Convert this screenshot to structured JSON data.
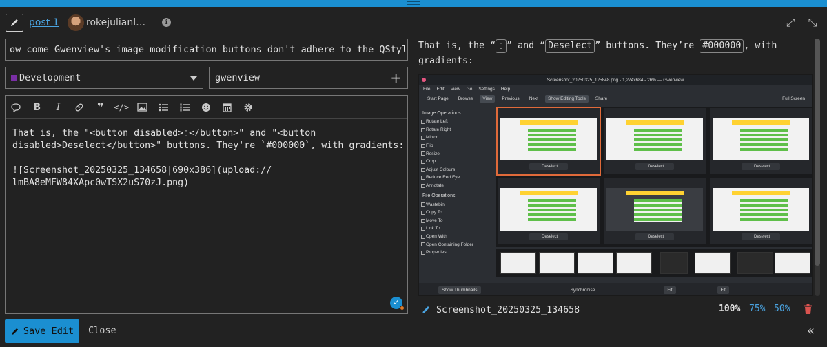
{
  "header": {
    "post_link": "post 1",
    "username": "rokejulianl…"
  },
  "title": "ow come Gwenview's image modification buttons don't adhere to the QStyle?",
  "category": {
    "label": "Development",
    "color": "#7a2fa5"
  },
  "tags": {
    "value": "gwenview"
  },
  "toolbar": {
    "icons": [
      "speech-bubble-icon",
      "bold-icon",
      "italic-icon",
      "link-icon",
      "quote-icon",
      "code-icon",
      "image-icon",
      "bullet-list-icon",
      "numbered-list-icon",
      "emoji-icon",
      "calendar-icon",
      "gear-icon"
    ]
  },
  "editor": {
    "line1": "That is, the \"<button disabled>▯</button>\" and \"<button",
    "line2": "disabled>Deselect</button>\" buttons. They're `#000000`, with gradients:",
    "line3": "",
    "line4": "![Screenshot_20250325_134658|690x386](upload://",
    "line5": "lmBA8eMFW84XApc0wTSX2uS70zJ.png)"
  },
  "actions": {
    "save_label": "Save Edit",
    "close_label": "Close"
  },
  "preview": {
    "text_a": "That is, the “",
    "chip1": "▯",
    "text_b": "” and “",
    "chip2": "Deselect",
    "text_c": "” buttons. They’re ",
    "chip3": "#000000",
    "text_d": ", with",
    "text_e": "gradients:"
  },
  "gwenview": {
    "window_title": "Screenshot_20250325_125848.png - 1,274x684 - 26% — Gwenview",
    "menu": [
      "File",
      "Edit",
      "View",
      "Go",
      "Settings",
      "Help"
    ],
    "tools": [
      "Start Page",
      "Browse",
      "View",
      "Previous",
      "Next",
      "Show Editing Tools",
      "Share"
    ],
    "full_screen": "Full Screen",
    "image_ops_header": "Image Operations",
    "image_ops": [
      "Rotate Left",
      "Rotate Right",
      "Mirror",
      "Flip",
      "Resize",
      "Crop",
      "Adjust Colours",
      "Reduce Red Eye",
      "Annotate"
    ],
    "file_ops_header": "File Operations",
    "file_ops": [
      "Wastebin",
      "Copy To",
      "Move To",
      "Link To",
      "Open With",
      "Open Containing Folder",
      "Properties"
    ],
    "deselect": "Deselect",
    "show_thumbnails": "Show Thumbnails",
    "synchronise": "Synchronise",
    "fit": "Fit",
    "fit2": "Fit"
  },
  "image_caption": {
    "filename": "Screenshot_20250325_134658",
    "zoom_100": "100%",
    "zoom_75": "75%",
    "zoom_50": "50%"
  }
}
